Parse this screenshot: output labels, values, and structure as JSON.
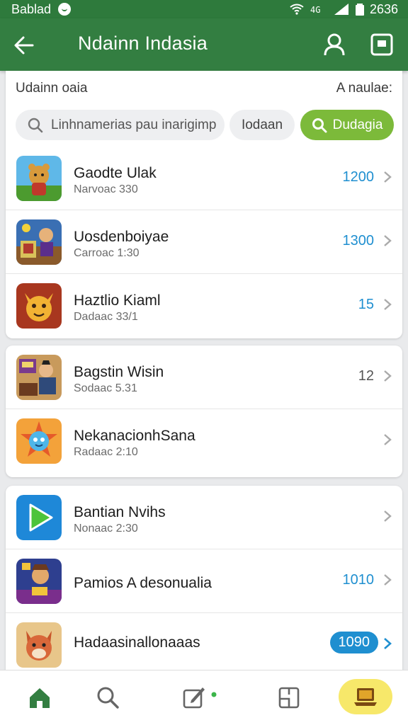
{
  "status_bar": {
    "left_text": "Bablad",
    "right_text": "2636"
  },
  "app_bar": {
    "title": "Ndainn Indasia"
  },
  "header": {
    "left_label": "Udainn oaia",
    "right_label": "A naulae:"
  },
  "search": {
    "placeholder": "Linhnamerias pau inarigimp",
    "today_label": "Iodaan",
    "go_label": "Dudagia"
  },
  "groups": [
    {
      "items": [
        {
          "name": "Gaodte Ulak",
          "sub": "Narvoac 330",
          "value": "1200",
          "style": "blue",
          "icon": "bear-game-icon"
        },
        {
          "name": "Uosdenboiyae",
          "sub": "Carroac 1:30",
          "value": "1300",
          "style": "blue",
          "icon": "battle-game-icon"
        },
        {
          "name": "Haztlio Kiaml",
          "sub": "Dadaac 33/1",
          "value": "15",
          "style": "blue",
          "icon": "cat-face-icon"
        }
      ]
    },
    {
      "items": [
        {
          "name": "Bagstin Wisin",
          "sub": "Sodaac 5.31",
          "value": "12",
          "style": "gray",
          "icon": "pirate-game-icon"
        },
        {
          "name": "NekanacionhSana",
          "sub": "Radaac 2:10",
          "value": "",
          "style": "none",
          "icon": "bird-star-icon"
        }
      ]
    },
    {
      "items": [
        {
          "name": "Bantian Nvihs",
          "sub": "Nonaac 2:30",
          "value": "",
          "style": "none",
          "icon": "play-icon"
        },
        {
          "name": "Pamios A desonualia",
          "sub": "",
          "value": "1010",
          "style": "blue",
          "icon": "hero-game-icon"
        },
        {
          "name": "Hadaasinallonaaas",
          "sub": "",
          "value": "1090",
          "style": "badge",
          "icon": "fox-game-icon"
        }
      ]
    }
  ],
  "bottom_nav": [
    "home-icon",
    "search-icon",
    "edit-icon",
    "book-icon",
    "laptop-icon"
  ],
  "colors": {
    "primary": "#337e41",
    "accent_green": "#7cba3a",
    "accent_blue": "#1f8fd0",
    "active_nav": "#f7e86a"
  }
}
